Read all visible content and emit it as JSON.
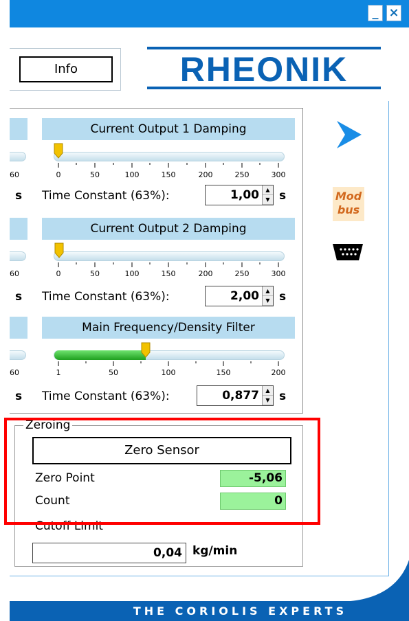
{
  "window": {
    "minimize_label": "_",
    "close_label": "×",
    "accent_color": "#0f87e0"
  },
  "header": {
    "info_label": "Info",
    "logo_text": "RHEONIK"
  },
  "damping": [
    {
      "title": "Current Output 1 Damping",
      "ticks": [
        "0",
        "50",
        "100",
        "150",
        "200",
        "250",
        "300"
      ],
      "left_tick": "60",
      "left_unit": "s",
      "slider_value": 1,
      "slider_max": 300,
      "time_constant_label": "Time Constant (63%):",
      "value": "1,00",
      "unit": "s"
    },
    {
      "title": "Current Output 2 Damping",
      "ticks": [
        "0",
        "50",
        "100",
        "150",
        "200",
        "250",
        "300"
      ],
      "left_tick": "60",
      "left_unit": "s",
      "slider_value": 2,
      "slider_max": 300,
      "time_constant_label": "Time Constant (63%):",
      "value": "2,00",
      "unit": "s"
    },
    {
      "title": "Main Frequency/Density Filter",
      "ticks": [
        "1",
        "50",
        "100",
        "150",
        "200"
      ],
      "left_tick": "60",
      "left_unit": "s",
      "slider_value": 80,
      "slider_max": 200,
      "time_constant_label": "Time Constant (63%):",
      "value": "0,877",
      "unit": "s"
    }
  ],
  "side_icons": {
    "send": "send-icon",
    "modbus_line1": "Mod",
    "modbus_line2": "bus",
    "serial": "serial-port-icon"
  },
  "zeroing": {
    "group_label": "Zeroing",
    "zero_button": "Zero Sensor",
    "zero_point_label": "Zero Point",
    "zero_point_value": "-5,06",
    "count_label": "Count",
    "count_value": "0",
    "cutoff_label": "Cutoff Limit",
    "cutoff_value": "0,04",
    "cutoff_unit": "kg/min"
  },
  "footer": {
    "tagline": "THE CORIOLIS EXPERTS"
  }
}
